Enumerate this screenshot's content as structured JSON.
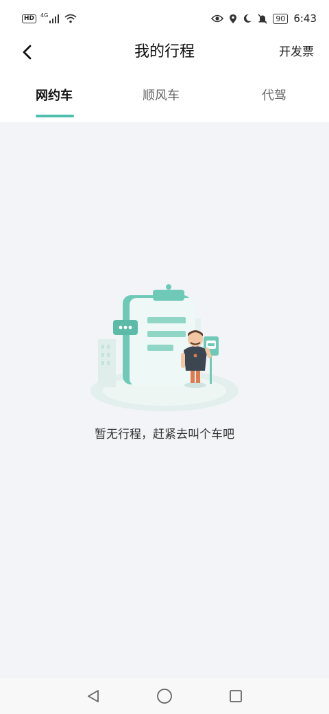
{
  "status_bar": {
    "hd_badge": "HD",
    "network": "4G",
    "battery": "90",
    "time": "6:43"
  },
  "header": {
    "title": "我的行程",
    "invoice_label": "开发票"
  },
  "tabs": [
    {
      "label": "网约车",
      "active": true
    },
    {
      "label": "顺风车",
      "active": false
    },
    {
      "label": "代驾",
      "active": false
    }
  ],
  "empty_state": {
    "message": "暂无行程，赶紧去叫个车吧"
  },
  "colors": {
    "accent": "#4fc0ad",
    "background": "#f2f4f7",
    "header_bg": "#ffffff"
  },
  "icons": {
    "back": "chevron-left-icon",
    "nav_back": "triangle-back-icon",
    "nav_home": "circle-home-icon",
    "nav_recent": "square-recent-icon"
  }
}
